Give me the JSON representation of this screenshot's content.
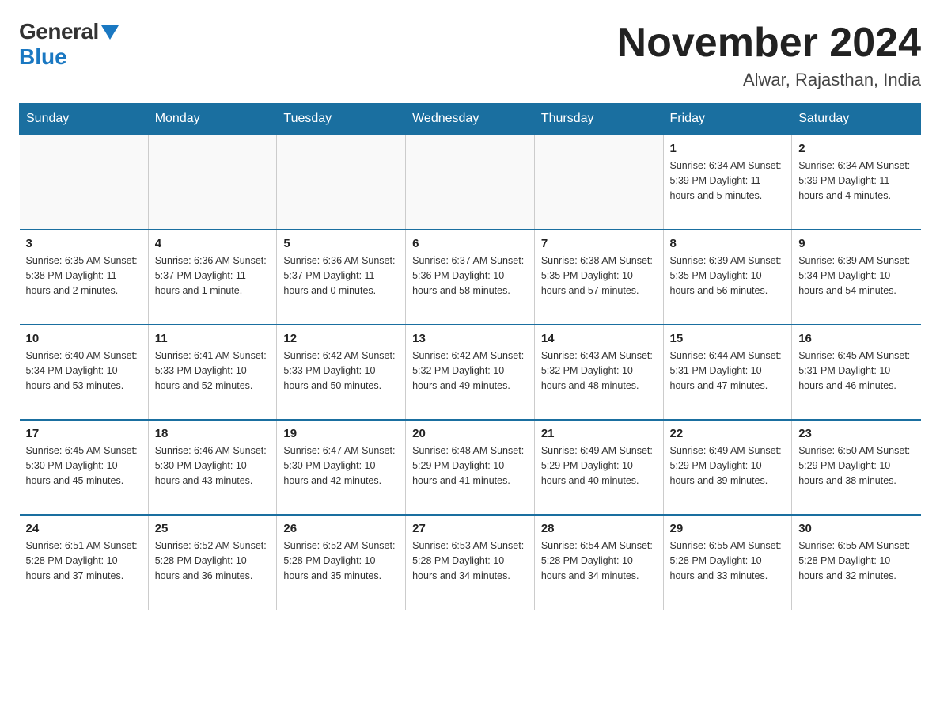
{
  "logo": {
    "general": "General",
    "blue": "Blue"
  },
  "title": "November 2024",
  "location": "Alwar, Rajasthan, India",
  "days_of_week": [
    "Sunday",
    "Monday",
    "Tuesday",
    "Wednesday",
    "Thursday",
    "Friday",
    "Saturday"
  ],
  "weeks": [
    [
      {
        "day": "",
        "info": ""
      },
      {
        "day": "",
        "info": ""
      },
      {
        "day": "",
        "info": ""
      },
      {
        "day": "",
        "info": ""
      },
      {
        "day": "",
        "info": ""
      },
      {
        "day": "1",
        "info": "Sunrise: 6:34 AM\nSunset: 5:39 PM\nDaylight: 11 hours and 5 minutes."
      },
      {
        "day": "2",
        "info": "Sunrise: 6:34 AM\nSunset: 5:39 PM\nDaylight: 11 hours and 4 minutes."
      }
    ],
    [
      {
        "day": "3",
        "info": "Sunrise: 6:35 AM\nSunset: 5:38 PM\nDaylight: 11 hours and 2 minutes."
      },
      {
        "day": "4",
        "info": "Sunrise: 6:36 AM\nSunset: 5:37 PM\nDaylight: 11 hours and 1 minute."
      },
      {
        "day": "5",
        "info": "Sunrise: 6:36 AM\nSunset: 5:37 PM\nDaylight: 11 hours and 0 minutes."
      },
      {
        "day": "6",
        "info": "Sunrise: 6:37 AM\nSunset: 5:36 PM\nDaylight: 10 hours and 58 minutes."
      },
      {
        "day": "7",
        "info": "Sunrise: 6:38 AM\nSunset: 5:35 PM\nDaylight: 10 hours and 57 minutes."
      },
      {
        "day": "8",
        "info": "Sunrise: 6:39 AM\nSunset: 5:35 PM\nDaylight: 10 hours and 56 minutes."
      },
      {
        "day": "9",
        "info": "Sunrise: 6:39 AM\nSunset: 5:34 PM\nDaylight: 10 hours and 54 minutes."
      }
    ],
    [
      {
        "day": "10",
        "info": "Sunrise: 6:40 AM\nSunset: 5:34 PM\nDaylight: 10 hours and 53 minutes."
      },
      {
        "day": "11",
        "info": "Sunrise: 6:41 AM\nSunset: 5:33 PM\nDaylight: 10 hours and 52 minutes."
      },
      {
        "day": "12",
        "info": "Sunrise: 6:42 AM\nSunset: 5:33 PM\nDaylight: 10 hours and 50 minutes."
      },
      {
        "day": "13",
        "info": "Sunrise: 6:42 AM\nSunset: 5:32 PM\nDaylight: 10 hours and 49 minutes."
      },
      {
        "day": "14",
        "info": "Sunrise: 6:43 AM\nSunset: 5:32 PM\nDaylight: 10 hours and 48 minutes."
      },
      {
        "day": "15",
        "info": "Sunrise: 6:44 AM\nSunset: 5:31 PM\nDaylight: 10 hours and 47 minutes."
      },
      {
        "day": "16",
        "info": "Sunrise: 6:45 AM\nSunset: 5:31 PM\nDaylight: 10 hours and 46 minutes."
      }
    ],
    [
      {
        "day": "17",
        "info": "Sunrise: 6:45 AM\nSunset: 5:30 PM\nDaylight: 10 hours and 45 minutes."
      },
      {
        "day": "18",
        "info": "Sunrise: 6:46 AM\nSunset: 5:30 PM\nDaylight: 10 hours and 43 minutes."
      },
      {
        "day": "19",
        "info": "Sunrise: 6:47 AM\nSunset: 5:30 PM\nDaylight: 10 hours and 42 minutes."
      },
      {
        "day": "20",
        "info": "Sunrise: 6:48 AM\nSunset: 5:29 PM\nDaylight: 10 hours and 41 minutes."
      },
      {
        "day": "21",
        "info": "Sunrise: 6:49 AM\nSunset: 5:29 PM\nDaylight: 10 hours and 40 minutes."
      },
      {
        "day": "22",
        "info": "Sunrise: 6:49 AM\nSunset: 5:29 PM\nDaylight: 10 hours and 39 minutes."
      },
      {
        "day": "23",
        "info": "Sunrise: 6:50 AM\nSunset: 5:29 PM\nDaylight: 10 hours and 38 minutes."
      }
    ],
    [
      {
        "day": "24",
        "info": "Sunrise: 6:51 AM\nSunset: 5:28 PM\nDaylight: 10 hours and 37 minutes."
      },
      {
        "day": "25",
        "info": "Sunrise: 6:52 AM\nSunset: 5:28 PM\nDaylight: 10 hours and 36 minutes."
      },
      {
        "day": "26",
        "info": "Sunrise: 6:52 AM\nSunset: 5:28 PM\nDaylight: 10 hours and 35 minutes."
      },
      {
        "day": "27",
        "info": "Sunrise: 6:53 AM\nSunset: 5:28 PM\nDaylight: 10 hours and 34 minutes."
      },
      {
        "day": "28",
        "info": "Sunrise: 6:54 AM\nSunset: 5:28 PM\nDaylight: 10 hours and 34 minutes."
      },
      {
        "day": "29",
        "info": "Sunrise: 6:55 AM\nSunset: 5:28 PM\nDaylight: 10 hours and 33 minutes."
      },
      {
        "day": "30",
        "info": "Sunrise: 6:55 AM\nSunset: 5:28 PM\nDaylight: 10 hours and 32 minutes."
      }
    ]
  ]
}
